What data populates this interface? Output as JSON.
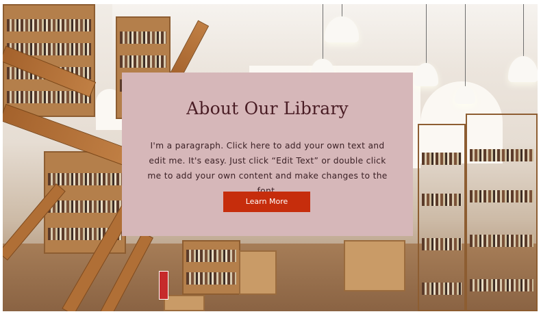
{
  "section": {
    "title": "About Our Library",
    "paragraph": "I'm a paragraph. Click here to add your own text and edit me. It's easy. Just click “Edit Text” or double click me to add your own content and make changes to the font.",
    "button_label": "Learn More"
  },
  "colors": {
    "card_background": "#d6b7b9",
    "title_color": "#4a1d25",
    "button_background": "#c62d0c",
    "button_text": "#ffffff"
  },
  "background": {
    "description_icon": "library-interior-photo"
  }
}
